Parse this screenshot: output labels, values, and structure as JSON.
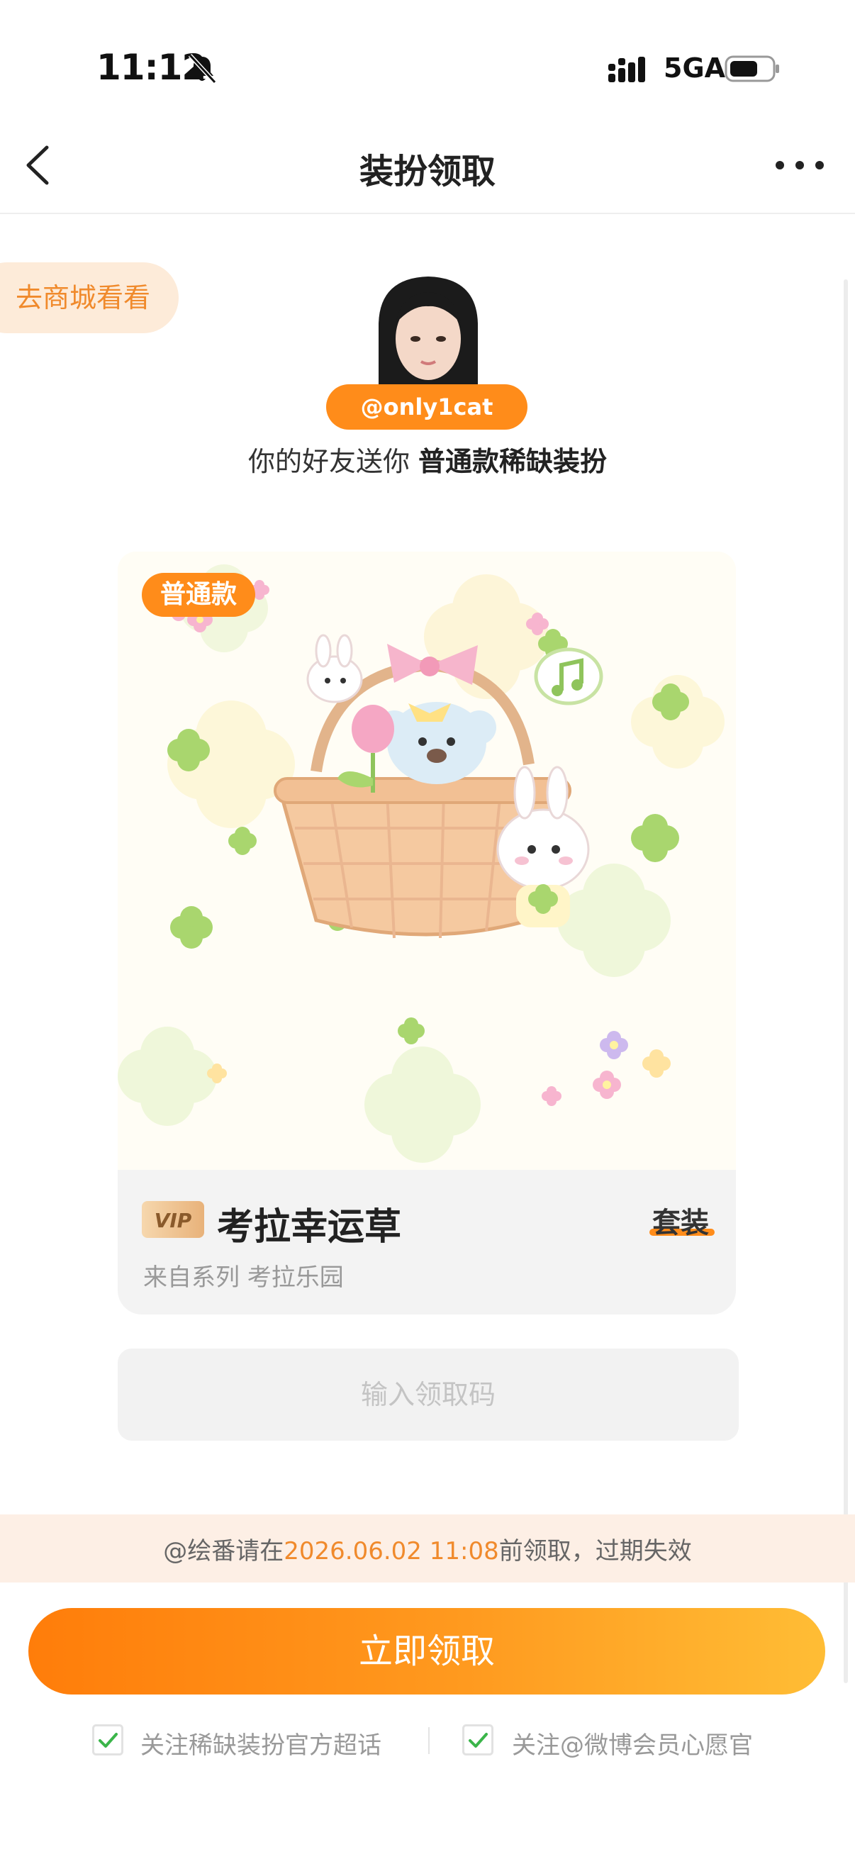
{
  "status_bar": {
    "time": "11:12",
    "network": "5GA",
    "icons": [
      "bell-muted-icon",
      "signal-icon",
      "battery-icon"
    ]
  },
  "nav": {
    "title": "装扮领取",
    "icons": [
      "back-arrow-icon",
      "more-icon"
    ]
  },
  "store_link": "去商城看看",
  "sender": {
    "handle": "@only1cat",
    "message_prefix": "你的好友送你 ",
    "message_item": "普通款稀缺装扮"
  },
  "card": {
    "badge": "普通款",
    "vip_label": "VIP",
    "name": "考拉幸运草",
    "type": "套装",
    "series": "来自系列   考拉乐园"
  },
  "code_input": {
    "placeholder": "输入领取码",
    "value": ""
  },
  "notice": {
    "prefix": "@绘番请在",
    "deadline": "2026.06.02 11:08",
    "suffix": "前领取，过期失效"
  },
  "claim_button": "立即领取",
  "follow_options": [
    {
      "label": "关注稀缺装扮官方超话",
      "checked": true
    },
    {
      "label": "关注@微博会员心愿官",
      "checked": true
    }
  ],
  "colors": {
    "accent": "#ff8c1a",
    "notice_bg": "#fdefe5",
    "card_info_bg": "#f3f3f3",
    "check_green": "#3bb54a"
  }
}
